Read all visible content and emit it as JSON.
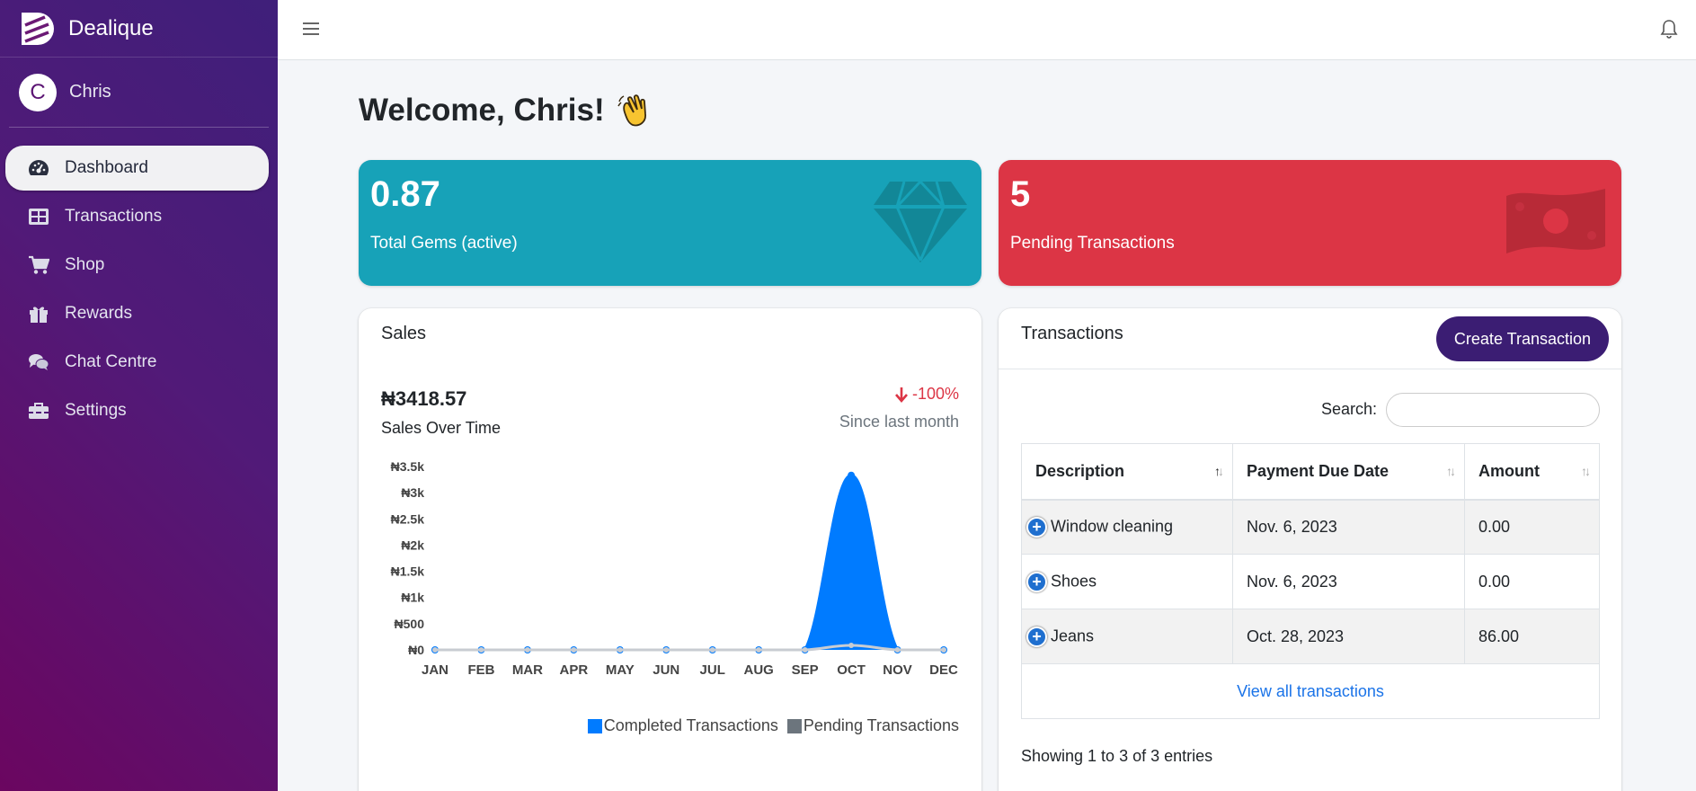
{
  "brand": {
    "name": "Dealique"
  },
  "user": {
    "initial": "C",
    "name": "Chris"
  },
  "nav": [
    {
      "label": "Dashboard",
      "icon": "gauge-icon",
      "active": true
    },
    {
      "label": "Transactions",
      "icon": "table-icon"
    },
    {
      "label": "Shop",
      "icon": "cart-icon"
    },
    {
      "label": "Rewards",
      "icon": "gift-icon"
    },
    {
      "label": "Chat Centre",
      "icon": "comments-icon"
    },
    {
      "label": "Settings",
      "icon": "toolbox-icon"
    }
  ],
  "welcome": {
    "prefix": "Welcome, ",
    "name": "Chris",
    "suffix": "!"
  },
  "stats": {
    "gems": {
      "value": "0.87",
      "label": "Total Gems (active)",
      "color": "#17a2b8",
      "icon": "gem-icon"
    },
    "pending": {
      "value": "5",
      "label": "Pending Transactions",
      "color": "#dc3545",
      "icon": "money-bill-icon"
    }
  },
  "sales": {
    "title": "Sales",
    "amount": "₦3418.57",
    "subtitle": "Sales Over Time",
    "change": "-100%",
    "since": "Since last month"
  },
  "chart_data": {
    "type": "area",
    "categories": [
      "JAN",
      "FEB",
      "MAR",
      "APR",
      "MAY",
      "JUN",
      "JUL",
      "AUG",
      "SEP",
      "OCT",
      "NOV",
      "DEC"
    ],
    "series": [
      {
        "name": "Completed Transactions",
        "color": "#007bff",
        "values": [
          0,
          0,
          0,
          0,
          0,
          0,
          0,
          0,
          0,
          3332.57,
          0,
          0
        ]
      },
      {
        "name": "Pending Transactions",
        "color": "#6c757d",
        "values": [
          0,
          0,
          0,
          0,
          0,
          0,
          0,
          0,
          0,
          86,
          0,
          0
        ]
      }
    ],
    "ylim": [
      0,
      3500
    ],
    "yticks": [
      "₦0",
      "₦500",
      "₦1k",
      "₦1.5k",
      "₦2k",
      "₦2.5k",
      "₦3k",
      "₦3.5k"
    ],
    "legend": "bottom-right",
    "grid": false
  },
  "transactions": {
    "title": "Transactions",
    "create_label": "Create Transaction",
    "search_label": "Search:",
    "columns": [
      "Description",
      "Payment Due Date",
      "Amount"
    ],
    "rows": [
      {
        "description": "Window cleaning",
        "due": "Nov. 6, 2023",
        "amount": "0.00"
      },
      {
        "description": "Shoes",
        "due": "Nov. 6, 2023",
        "amount": "0.00"
      },
      {
        "description": "Jeans",
        "due": "Oct. 28, 2023",
        "amount": "86.00"
      }
    ],
    "view_all": "View all transactions",
    "showing": "Showing 1 to 3 of 3 entries"
  }
}
